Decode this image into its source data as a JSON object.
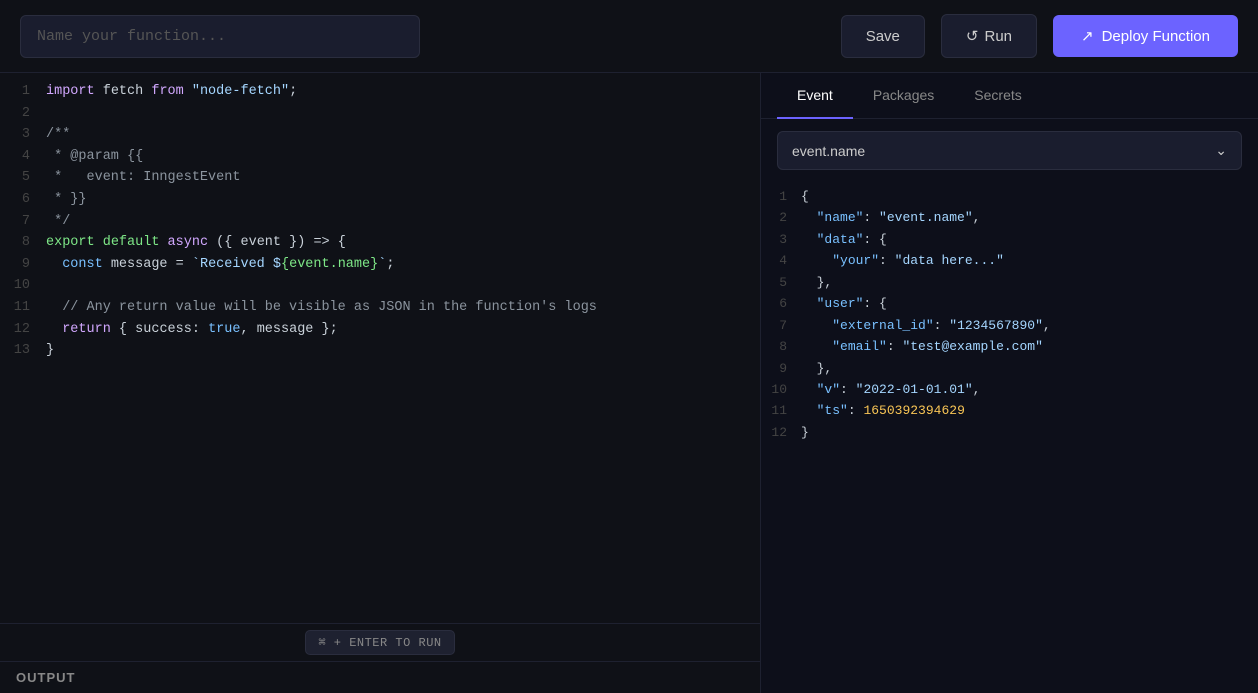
{
  "header": {
    "name_placeholder": "Name your function...",
    "save_label": "Save",
    "run_label": "Run",
    "deploy_label": "Deploy Function",
    "run_icon": "↺",
    "deploy_icon": "↗"
  },
  "tabs": {
    "items": [
      {
        "label": "Event",
        "active": true
      },
      {
        "label": "Packages",
        "active": false
      },
      {
        "label": "Secrets",
        "active": false
      }
    ]
  },
  "event_dropdown": {
    "value": "event.name",
    "chevron": "⌄"
  },
  "output_label": "OUTPUT",
  "shortcut": "⌘ + ENTER TO RUN"
}
